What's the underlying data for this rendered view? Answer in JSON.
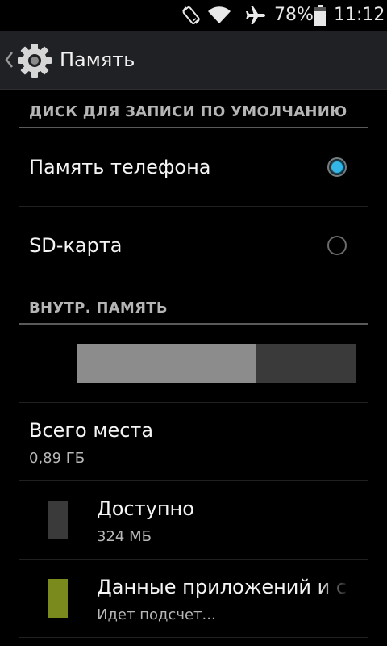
{
  "status_bar": {
    "battery_percent": "78%",
    "clock": "11:12",
    "icons": [
      "rotate-icon",
      "wifi-icon",
      "airplane-icon",
      "battery-icon"
    ],
    "battery_level": 0.78
  },
  "action_bar": {
    "title": "Память",
    "icon": "gear-icon"
  },
  "sections": {
    "default_disk": {
      "header": "ДИСК ДЛЯ ЗАПИСИ ПО УМОЛЧАНИЮ",
      "options": [
        {
          "label": "Память телефона",
          "selected": true
        },
        {
          "label": "SD-карта",
          "selected": false
        }
      ]
    },
    "internal": {
      "header": "ВНУТР. ПАМЯТЬ",
      "usage_fraction": 0.64,
      "total": {
        "title": "Всего места",
        "value": "0,89 ГБ"
      },
      "items": [
        {
          "title": "Доступно",
          "value": "324 МБ",
          "color": "#3a3a3a"
        },
        {
          "title": "Данные приложений и с",
          "value": "Идет подсчет...",
          "color": "#7a8a1c"
        }
      ]
    }
  },
  "colors": {
    "accent": "#33b5e5",
    "action_bar_bg": "#202124",
    "divider": "#5a5a5a"
  }
}
